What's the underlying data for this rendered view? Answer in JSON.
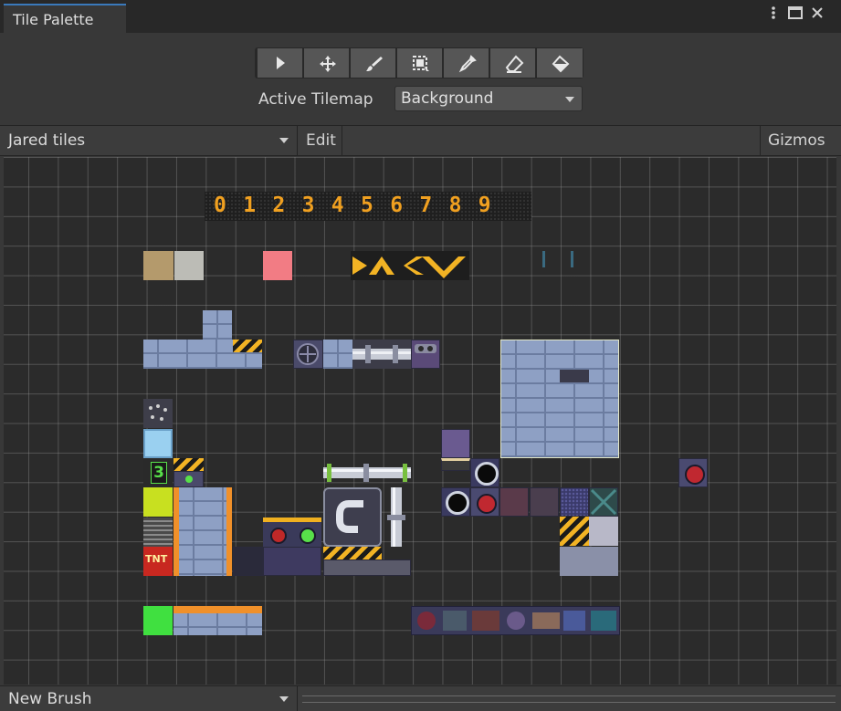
{
  "window": {
    "tab_title": "Tile Palette",
    "more_icon": "kebab-menu-icon",
    "maximize_icon": "maximize-icon",
    "close_icon": "close-icon"
  },
  "toolbar": {
    "tools": [
      {
        "name": "select-tool",
        "icon": "arrow-cursor-icon"
      },
      {
        "name": "move-tool",
        "icon": "move-arrows-icon"
      },
      {
        "name": "paint-tool",
        "icon": "brush-icon"
      },
      {
        "name": "box-fill-tool",
        "icon": "box-select-icon"
      },
      {
        "name": "picker-tool",
        "icon": "eyedropper-icon"
      },
      {
        "name": "erase-tool",
        "icon": "eraser-icon"
      },
      {
        "name": "fill-tool",
        "icon": "paint-bucket-icon"
      }
    ],
    "active_tool": "none"
  },
  "active_tilemap": {
    "label": "Active Tilemap",
    "value": "Background"
  },
  "palette_bar": {
    "palette": "Jared tiles",
    "edit_label": "Edit",
    "gizmos_label": "Gizmos"
  },
  "counter_digits": [
    "0",
    "1",
    "2",
    "3",
    "4",
    "5",
    "6",
    "7",
    "8",
    "9"
  ],
  "tnt_label": "TNT",
  "number_tile": "3",
  "bottom_bar": {
    "brush": "New Brush"
  },
  "colors": {
    "accent": "#3a79bb",
    "digit": "#f0a020",
    "panel": "#383838",
    "grid_bg": "#2b2b2b"
  }
}
